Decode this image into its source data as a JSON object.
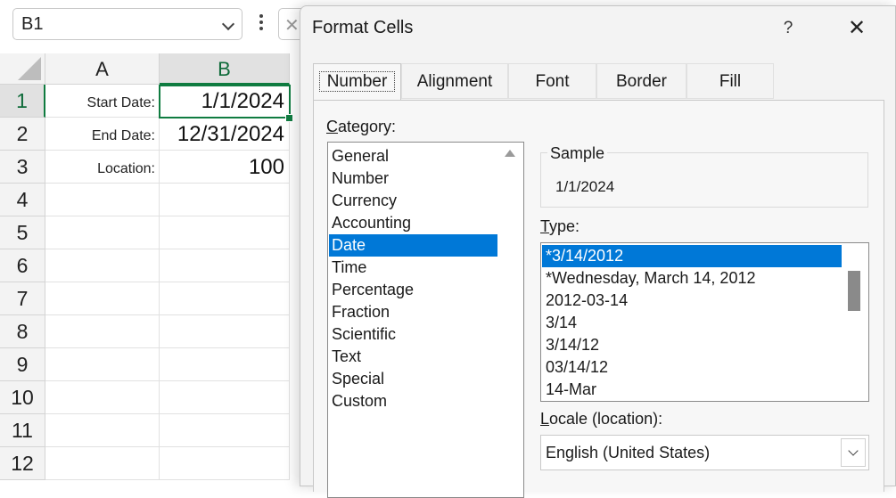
{
  "spreadsheet": {
    "name_box": "B1",
    "columns": [
      "A",
      "B"
    ],
    "rows": [
      "1",
      "2",
      "3",
      "4",
      "5",
      "6",
      "7",
      "8",
      "9",
      "10",
      "11",
      "12"
    ],
    "cells": [
      {
        "a": "Start Date:",
        "b": "1/1/2024"
      },
      {
        "a": "End Date:",
        "b": "12/31/2024"
      },
      {
        "a": "Location:",
        "b": "100"
      }
    ]
  },
  "dialog": {
    "title": "Format Cells",
    "help": "?",
    "close": "✕",
    "tabs": [
      "Number",
      "Alignment",
      "Font",
      "Border",
      "Fill"
    ],
    "active_tab": "Number",
    "category_label_prefix": "C",
    "category_label_rest": "ategory:",
    "categories": [
      "General",
      "Number",
      "Currency",
      "Accounting",
      "Date",
      "Time",
      "Percentage",
      "Fraction",
      "Scientific",
      "Text",
      "Special",
      "Custom"
    ],
    "selected_category": "Date",
    "sample_label": "Sample",
    "sample_value": "1/1/2024",
    "type_label_prefix": "T",
    "type_label_rest": "ype:",
    "types": [
      "*3/14/2012",
      "*Wednesday, March 14, 2012",
      "2012-03-14",
      "3/14",
      "3/14/12",
      "03/14/12",
      "14-Mar"
    ],
    "selected_type": "*3/14/2012",
    "locale_label_prefix": "L",
    "locale_label_rest": "ocale (location):",
    "locale_value": "English (United States)"
  },
  "colors": {
    "accent": "#0078d7",
    "excel_green": "#107c41"
  }
}
